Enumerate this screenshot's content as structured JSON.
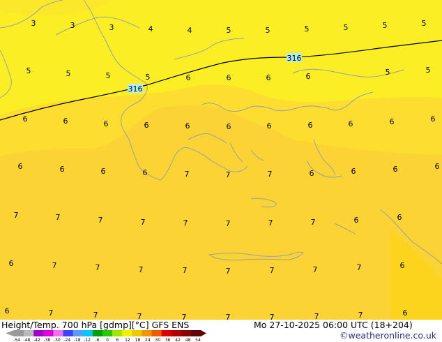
{
  "map": {
    "colors": {
      "zone3": "#fce82a",
      "zone4": "#fce82a",
      "zone5": "#fcee24",
      "zone6": "#fcdd30",
      "zone7": "#fcd334",
      "corner": "#fcd41e",
      "coast": "#9aa0a8",
      "contour": "#000000",
      "contour_label_bg": "#aeeefa"
    },
    "contour_label": "316",
    "temp_labels": [
      "3",
      "3",
      "3",
      "4",
      "4",
      "5",
      "5",
      "5",
      "5",
      "5",
      "5",
      "5",
      "5",
      "5",
      "5",
      "6",
      "6",
      "6",
      "6",
      "5",
      "5",
      "6",
      "6",
      "6",
      "6",
      "6",
      "6",
      "6",
      "6",
      "6",
      "6",
      "6",
      "6",
      "6",
      "6",
      "6",
      "7",
      "7",
      "7",
      "6",
      "6",
      "6",
      "6",
      "7",
      "7",
      "7",
      "7",
      "7",
      "7",
      "7",
      "7",
      "6",
      "6",
      "6",
      "7",
      "7",
      "7",
      "7",
      "7",
      "7",
      "7",
      "7",
      "6",
      "6",
      "7",
      "7",
      "7",
      "7",
      "7",
      "7",
      "7",
      "7",
      "6",
      "6"
    ]
  },
  "footer": {
    "title": "Height/Temp. 700 hPa [gdmp][°C] GFS ENS",
    "datetime": "Mo 27-10-2025 06:00 UTC (18+204)",
    "credit": "©weatheronline.co.uk"
  },
  "legend": {
    "ticks": [
      "-54",
      "-48",
      "-42",
      "-38",
      "-30",
      "-24",
      "-18",
      "-12",
      "-6",
      "0",
      "6",
      "12",
      "18",
      "24",
      "30",
      "36",
      "42",
      "48",
      "54"
    ],
    "colors": [
      "#9a9a9a",
      "#bababa",
      "#a000c8",
      "#dc00dc",
      "#f070f0",
      "#4040ff",
      "#5a9bff",
      "#00c8ff",
      "#00a000",
      "#28c800",
      "#a0e600",
      "#f0f000",
      "#f0c800",
      "#f09600",
      "#f05a00",
      "#dc0000",
      "#b40000",
      "#8c0000",
      "#600000"
    ]
  }
}
